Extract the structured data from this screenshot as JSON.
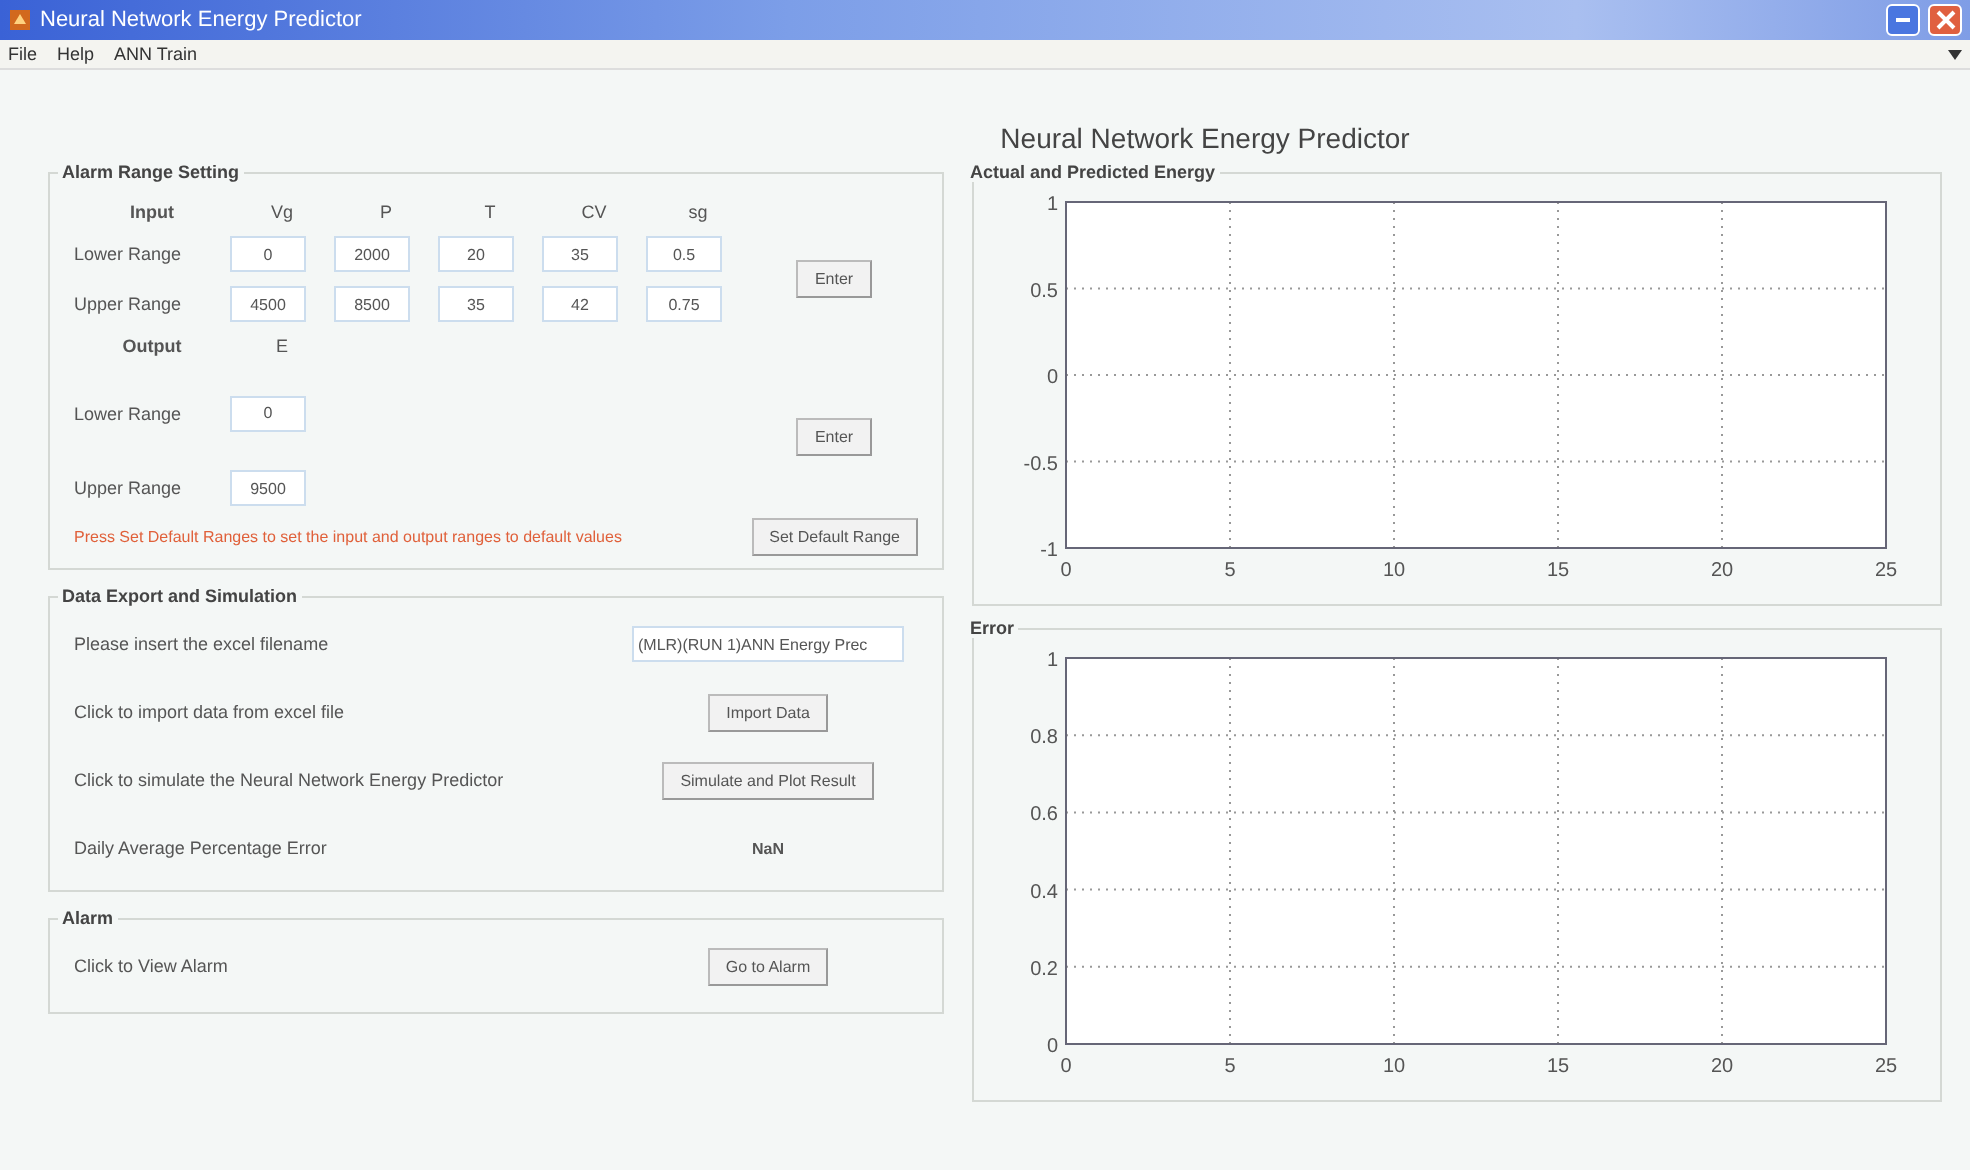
{
  "window": {
    "title": "Neural Network Energy Predictor"
  },
  "menu": [
    "File",
    "Help",
    "ANN Train"
  ],
  "heading": "Neural Network Energy Predictor",
  "range_panel": {
    "title": "Alarm Range Setting",
    "input_label": "Input",
    "input_columns": [
      "Vg",
      "P",
      "T",
      "CV",
      "sg"
    ],
    "input_rows": [
      {
        "label": "Lower Range",
        "values": [
          "0",
          "2000",
          "20",
          "35",
          "0.5"
        ]
      },
      {
        "label": "Upper Range",
        "values": [
          "4500",
          "8500",
          "35",
          "42",
          "0.75"
        ]
      }
    ],
    "input_button": "Enter",
    "output_label": "Output",
    "output_columns": [
      "E"
    ],
    "output_rows": [
      {
        "label": "Lower Range",
        "values": [
          "0"
        ]
      },
      {
        "label": "Upper Range",
        "values": [
          "9500"
        ]
      }
    ],
    "output_button": "Enter",
    "note": "Press Set Default Ranges to set the input and output ranges to default values",
    "default_button": "Set Default Range"
  },
  "data_panel": {
    "title": "Data Export and Simulation",
    "rows": [
      {
        "kind": "field",
        "label": "Please insert the excel filename",
        "value": "(MLR)(RUN 1)ANN Energy Prec"
      },
      {
        "kind": "button",
        "label": "Click to import data from excel file",
        "value": "Import Data"
      },
      {
        "kind": "button",
        "label": "Click to simulate the Neural Network Energy Predictor",
        "value": "Simulate and Plot Result"
      },
      {
        "kind": "text",
        "label": "Daily Average Percentage Error",
        "value": "NaN"
      }
    ]
  },
  "alarm_panel": {
    "title": "Alarm",
    "label": "Click to View Alarm",
    "button": "Go to Alarm"
  },
  "charts": [
    {
      "title": "Actual and Predicted Energy",
      "chart_data": {
        "type": "line",
        "xlim": [
          0,
          25
        ],
        "ylim": [
          -1,
          1
        ],
        "grid": true,
        "xticks": [
          0,
          5,
          10,
          15,
          20,
          25
        ],
        "yticks": [
          -1,
          -0.5,
          0,
          0.5,
          1
        ]
      }
    },
    {
      "title": "Error",
      "chart_data": {
        "type": "line",
        "xlim": [
          0,
          25
        ],
        "ylim": [
          0,
          1
        ],
        "grid": true,
        "xticks": [
          0,
          5,
          10,
          15,
          20,
          25
        ],
        "yticks": [
          0,
          0.2,
          0.4,
          0.6,
          0.8,
          1
        ]
      }
    }
  ]
}
